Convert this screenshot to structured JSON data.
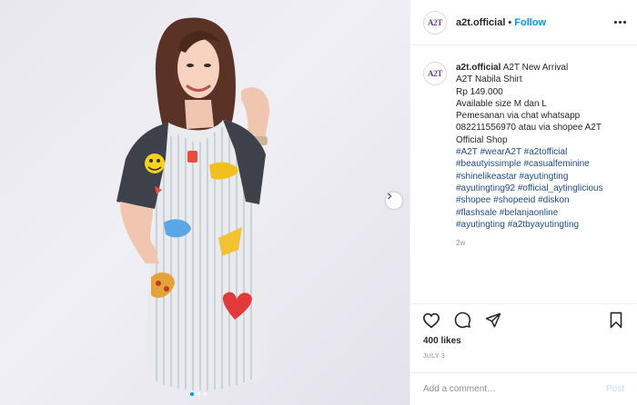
{
  "header": {
    "avatar_text": "A2T",
    "username": "a2t.official",
    "separator": "•",
    "follow_label": "Follow"
  },
  "caption": {
    "username": "a2t.official",
    "first_line": "A2T New Arrival",
    "lines": [
      "A2T Nabila Shirt",
      "Rp 149.000",
      "Available size M dan L",
      "Pemesanan via chat whatsapp",
      "082211556970 atau via shopee A2T",
      "Official Shop"
    ],
    "hashtag_lines": [
      "#A2T #wearA2T #a2tofficial",
      "#beautyissimple #casualfeminine",
      "#shinelikeastar #ayutingting",
      "#ayutingting92 #official_aytinglicious",
      "#shopee #shopeeid #diskon",
      "#flashsale #belanjaonline",
      "#ayutingting #a2tbyayutingting"
    ],
    "age": "2w"
  },
  "likes": "400 likes",
  "date": "JULY 3",
  "comment_box": {
    "placeholder": "Add a comment…",
    "post_label": "Post"
  },
  "colors": {
    "link": "#0095f6",
    "hashtag": "#1f4b86",
    "muted": "#8e8e8e"
  },
  "icons": [
    "heart-icon",
    "comment-icon",
    "share-icon",
    "bookmark-icon",
    "more-options-icon",
    "chevron-right-icon"
  ]
}
